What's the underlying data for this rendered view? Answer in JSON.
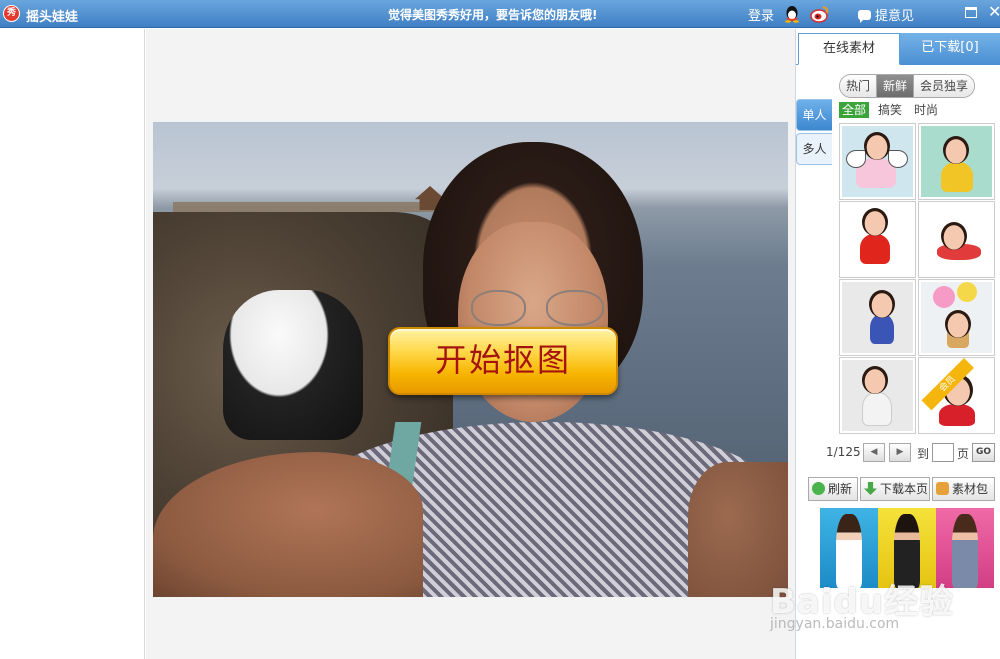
{
  "titlebar": {
    "logo_text": "秀",
    "title": "摇头娃娃",
    "slogan": "觉得美图秀秀好用，要告诉您的朋友哦!",
    "login": "登录",
    "feedback": "提意见",
    "close": "✕"
  },
  "canvas": {
    "start_button": "开始抠图"
  },
  "panel": {
    "tabs": [
      "在线素材",
      "已下载[0]"
    ],
    "categories": [
      "热门",
      "新鲜",
      "会员独享"
    ],
    "active_category": "新鲜",
    "side_tabs": [
      "单人",
      "多人"
    ],
    "filters": [
      "全部",
      "搞笑",
      "时尚"
    ],
    "active_filter": "全部",
    "member_badge": "会员",
    "pager": {
      "count": "1/125",
      "prev": "◀",
      "next": "▶",
      "to": "到",
      "page": "页",
      "go": "GO"
    },
    "actions": [
      "刷新",
      "下载本页",
      "素材包"
    ]
  },
  "watermark": {
    "brand": "Baidu经验",
    "url": "jingyan.baidu.com"
  },
  "colors": {
    "titlebar": "#4a8bd0",
    "start_button_text": "#a4130e",
    "active_filter": "#3aa33a",
    "badge": "#f4b60d"
  }
}
